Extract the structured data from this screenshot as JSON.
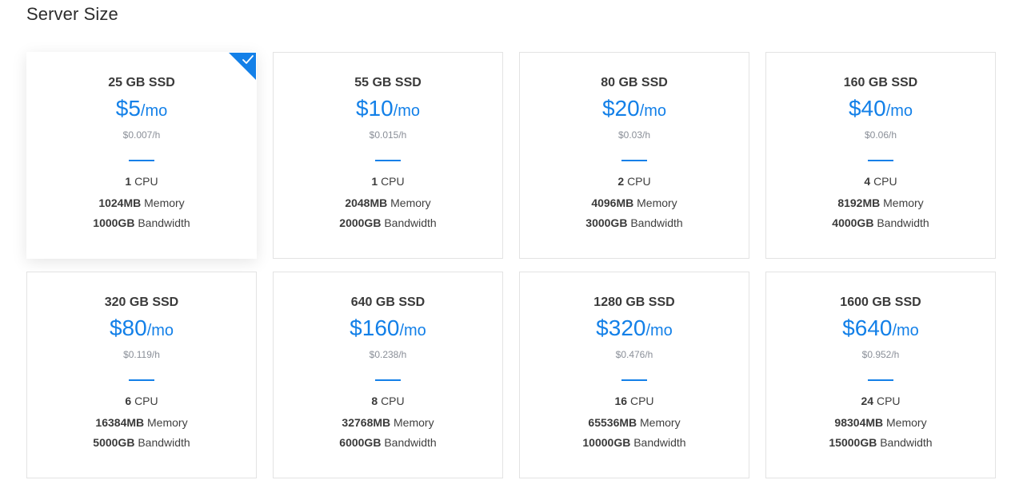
{
  "section_title": "Server Size",
  "colors": {
    "accent": "#1380e8",
    "text": "#3a3a3a",
    "muted": "#8a8f98",
    "border": "#e3e3e3"
  },
  "selected_index": 0,
  "plans": [
    {
      "disk": "25 GB SSD",
      "price": "$5",
      "per": "/mo",
      "hourly": "$0.007/h",
      "cpu": "1",
      "cpu_unit": "CPU",
      "memory": "1024MB",
      "memory_unit": "Memory",
      "bandwidth": "1000GB",
      "bandwidth_unit": "Bandwidth"
    },
    {
      "disk": "55 GB SSD",
      "price": "$10",
      "per": "/mo",
      "hourly": "$0.015/h",
      "cpu": "1",
      "cpu_unit": "CPU",
      "memory": "2048MB",
      "memory_unit": "Memory",
      "bandwidth": "2000GB",
      "bandwidth_unit": "Bandwidth"
    },
    {
      "disk": "80 GB SSD",
      "price": "$20",
      "per": "/mo",
      "hourly": "$0.03/h",
      "cpu": "2",
      "cpu_unit": "CPU",
      "memory": "4096MB",
      "memory_unit": "Memory",
      "bandwidth": "3000GB",
      "bandwidth_unit": "Bandwidth"
    },
    {
      "disk": "160 GB SSD",
      "price": "$40",
      "per": "/mo",
      "hourly": "$0.06/h",
      "cpu": "4",
      "cpu_unit": "CPU",
      "memory": "8192MB",
      "memory_unit": "Memory",
      "bandwidth": "4000GB",
      "bandwidth_unit": "Bandwidth"
    },
    {
      "disk": "320 GB SSD",
      "price": "$80",
      "per": "/mo",
      "hourly": "$0.119/h",
      "cpu": "6",
      "cpu_unit": "CPU",
      "memory": "16384MB",
      "memory_unit": "Memory",
      "bandwidth": "5000GB",
      "bandwidth_unit": "Bandwidth"
    },
    {
      "disk": "640 GB SSD",
      "price": "$160",
      "per": "/mo",
      "hourly": "$0.238/h",
      "cpu": "8",
      "cpu_unit": "CPU",
      "memory": "32768MB",
      "memory_unit": "Memory",
      "bandwidth": "6000GB",
      "bandwidth_unit": "Bandwidth"
    },
    {
      "disk": "1280 GB SSD",
      "price": "$320",
      "per": "/mo",
      "hourly": "$0.476/h",
      "cpu": "16",
      "cpu_unit": "CPU",
      "memory": "65536MB",
      "memory_unit": "Memory",
      "bandwidth": "10000GB",
      "bandwidth_unit": "Bandwidth"
    },
    {
      "disk": "1600 GB SSD",
      "price": "$640",
      "per": "/mo",
      "hourly": "$0.952/h",
      "cpu": "24",
      "cpu_unit": "CPU",
      "memory": "98304MB",
      "memory_unit": "Memory",
      "bandwidth": "15000GB",
      "bandwidth_unit": "Bandwidth"
    }
  ]
}
